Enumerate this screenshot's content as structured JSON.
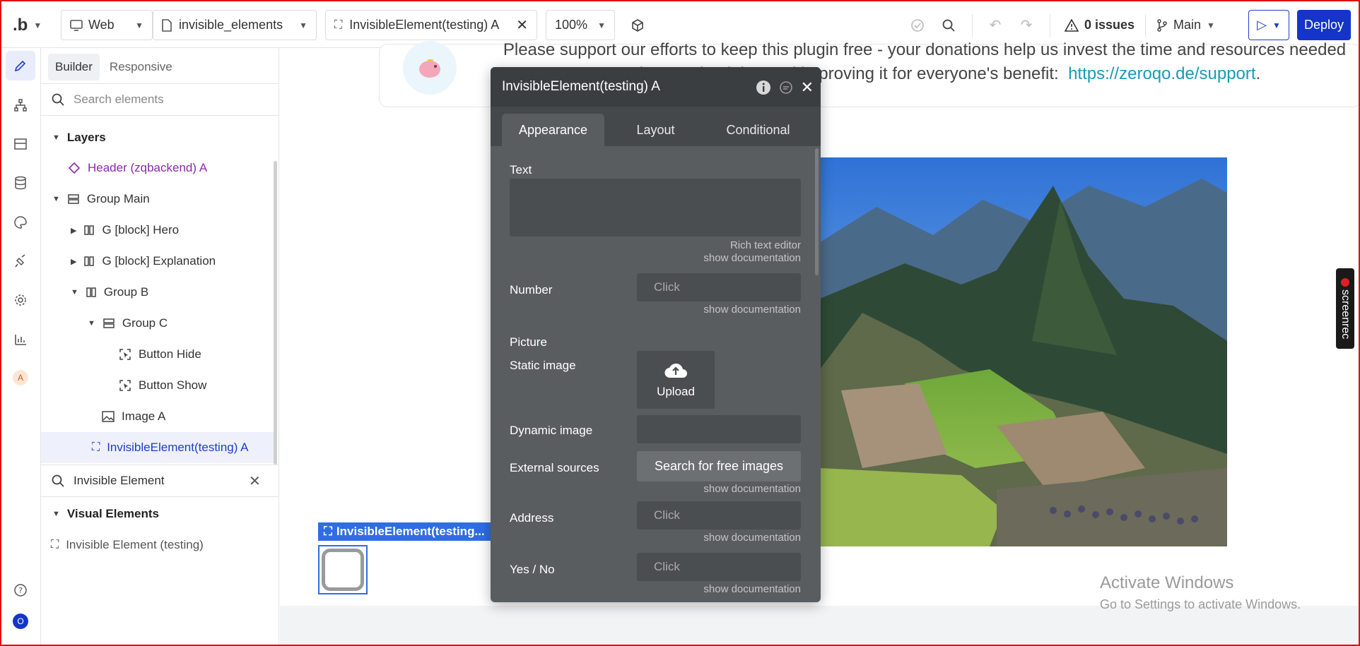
{
  "topbar": {
    "logo": ".b",
    "platform": "Web",
    "page_name": "invisible_elements",
    "element_name": "InvisibleElement(testing) A",
    "zoom": "100%",
    "issues": "0 issues",
    "branch": "Main",
    "deploy": "Deploy"
  },
  "panel": {
    "tabs": [
      "Builder",
      "Responsive"
    ],
    "search_placeholder": "Search elements",
    "layers_title": "Layers",
    "layers": [
      {
        "label": "Header (zqbackend) A"
      },
      {
        "label": "Group Main"
      },
      {
        "label": "G [block] Hero"
      },
      {
        "label": "G [block] Explanation"
      },
      {
        "label": "Group B"
      },
      {
        "label": "Group C"
      },
      {
        "label": "Button Hide"
      },
      {
        "label": "Button Show"
      },
      {
        "label": "Image A"
      },
      {
        "label": "InvisibleElement(testing) A"
      }
    ],
    "filter_value": "Invisible Element",
    "visual_title": "Visual Elements",
    "visual_items": [
      "Invisible Element (testing)"
    ]
  },
  "canvas": {
    "support_text": "Please support our efforts to keep this plugin free - your donations help us invest the time and resources needed to continue maintaining and improving it for everyone's benefit:",
    "support_link": "https://zeroqo.de/support",
    "selection_tag": "InvisibleElement(testing...",
    "activate_title": "Activate Windows",
    "activate_sub": "Go to Settings to activate Windows.",
    "screenrec": "screenrec"
  },
  "editor": {
    "title": "InvisibleElement(testing) A",
    "tabs": [
      "Appearance",
      "Layout",
      "Conditional"
    ],
    "text_label": "Text",
    "rich_text": "Rich text editor",
    "show_doc": "show documentation",
    "number_label": "Number",
    "click": "Click",
    "picture_label": "Picture",
    "static_image_label": "Static image",
    "upload": "Upload",
    "dynamic_image_label": "Dynamic image",
    "external_label": "External sources",
    "search_free": "Search for free images",
    "address_label": "Address",
    "yesno_label": "Yes / No"
  }
}
